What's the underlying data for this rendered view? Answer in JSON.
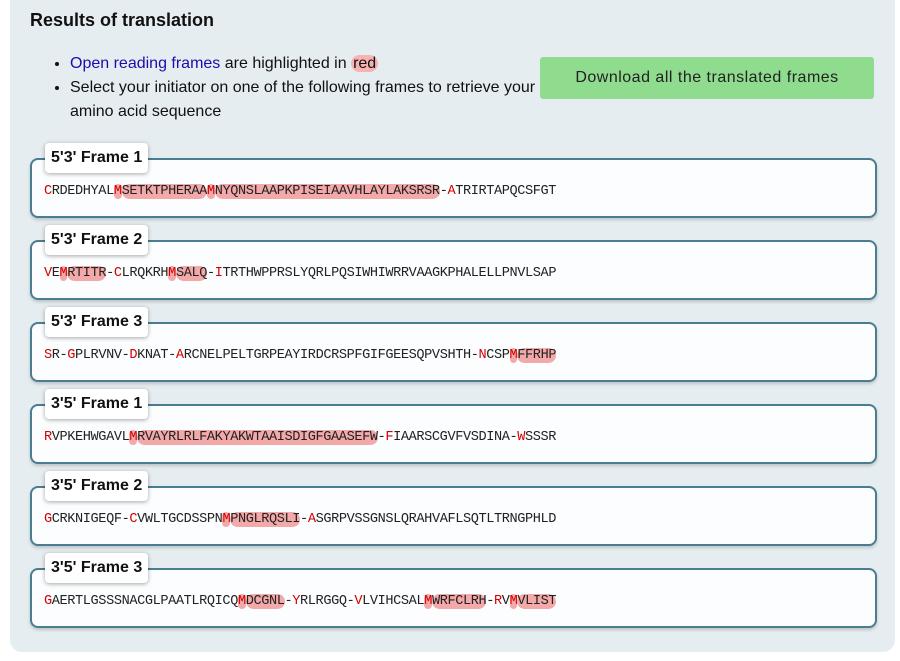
{
  "heading": "Results of translation",
  "info": {
    "orf_link": "Open reading frames",
    "orf_mid": " are highlighted in ",
    "orf_red": "red",
    "instruction": "Select your initiator on one of the following frames to retrieve your amino acid sequence"
  },
  "download_button": "Download all the translated frames",
  "colors": {
    "highlight": "#f3a9a9",
    "start_red": "#d40000",
    "button_green": "#8fdc8f",
    "frame_border": "#4a7d91"
  },
  "frames": [
    {
      "label": "5'3' Frame 1",
      "segments": [
        {
          "t": "C",
          "k": "r"
        },
        {
          "t": "RDEDHYAL",
          "k": "n"
        },
        {
          "t": "M",
          "k": "or"
        },
        {
          "t": "SETKTPHERAA",
          "k": "o"
        },
        {
          "t": "M",
          "k": "or"
        },
        {
          "t": "NYQNSLAAPKPISEIAAVHLAYLAKSRSR",
          "k": "o"
        },
        {
          "t": "-",
          "k": "n"
        },
        {
          "t": "A",
          "k": "r"
        },
        {
          "t": "TRIRTAPQCSFGT",
          "k": "n"
        }
      ]
    },
    {
      "label": "5'3' Frame 2",
      "segments": [
        {
          "t": "V",
          "k": "r"
        },
        {
          "t": "E",
          "k": "n"
        },
        {
          "t": "M",
          "k": "or"
        },
        {
          "t": "RTITR",
          "k": "o"
        },
        {
          "t": "-",
          "k": "n"
        },
        {
          "t": "C",
          "k": "r"
        },
        {
          "t": "LRQKRH",
          "k": "n"
        },
        {
          "t": "M",
          "k": "or"
        },
        {
          "t": "SALQ",
          "k": "o"
        },
        {
          "t": "-",
          "k": "n"
        },
        {
          "t": "I",
          "k": "r"
        },
        {
          "t": "TRTHWPPRSLYQRLPQSIWHIWRRVAAGKPHALELLPNVLSAP",
          "k": "n"
        }
      ]
    },
    {
      "label": "5'3' Frame 3",
      "segments": [
        {
          "t": "S",
          "k": "r"
        },
        {
          "t": "R-",
          "k": "n"
        },
        {
          "t": "G",
          "k": "r"
        },
        {
          "t": "PLRVNV-",
          "k": "n"
        },
        {
          "t": "D",
          "k": "r"
        },
        {
          "t": "KNAT-",
          "k": "n"
        },
        {
          "t": "A",
          "k": "r"
        },
        {
          "t": "RCNELPELTGRPEAYIRDCRSPFGIFGEESQPVSHTH-",
          "k": "n"
        },
        {
          "t": "N",
          "k": "r"
        },
        {
          "t": "CSP",
          "k": "n"
        },
        {
          "t": "M",
          "k": "or"
        },
        {
          "t": "FFRHP",
          "k": "o"
        }
      ]
    },
    {
      "label": "3'5' Frame 1",
      "segments": [
        {
          "t": "R",
          "k": "r"
        },
        {
          "t": "VPKEHWGAVL",
          "k": "n"
        },
        {
          "t": "M",
          "k": "or"
        },
        {
          "t": "RVAYRLRLFAKYAKWTAAISDIGFGAASEFW",
          "k": "o"
        },
        {
          "t": "-",
          "k": "n"
        },
        {
          "t": "F",
          "k": "r"
        },
        {
          "t": "IAARSCGVFVSDINA-",
          "k": "n"
        },
        {
          "t": "W",
          "k": "r"
        },
        {
          "t": "SSSR",
          "k": "n"
        }
      ]
    },
    {
      "label": "3'5' Frame 2",
      "segments": [
        {
          "t": "G",
          "k": "r"
        },
        {
          "t": "CRKNIGEQF-",
          "k": "n"
        },
        {
          "t": "C",
          "k": "r"
        },
        {
          "t": "VWLTGCDSSPN",
          "k": "n"
        },
        {
          "t": "M",
          "k": "or"
        },
        {
          "t": "PNGLRQSLI",
          "k": "o"
        },
        {
          "t": "-",
          "k": "n"
        },
        {
          "t": "A",
          "k": "r"
        },
        {
          "t": "SGRPVSSGNSLQRAHVAFLSQTLTRNGPHLD",
          "k": "n"
        }
      ]
    },
    {
      "label": "3'5' Frame 3",
      "segments": [
        {
          "t": "G",
          "k": "r"
        },
        {
          "t": "AERTLGSSSNACGLPAATLRQICQ",
          "k": "n"
        },
        {
          "t": "M",
          "k": "or"
        },
        {
          "t": "DCGNL",
          "k": "o"
        },
        {
          "t": "-",
          "k": "n"
        },
        {
          "t": "Y",
          "k": "r"
        },
        {
          "t": "RLRGGQ-",
          "k": "n"
        },
        {
          "t": "V",
          "k": "r"
        },
        {
          "t": "LVIHCSAL",
          "k": "n"
        },
        {
          "t": "M",
          "k": "or"
        },
        {
          "t": "WRFCLRH",
          "k": "o"
        },
        {
          "t": "-",
          "k": "n"
        },
        {
          "t": "R",
          "k": "r"
        },
        {
          "t": "V",
          "k": "n"
        },
        {
          "t": "M",
          "k": "or"
        },
        {
          "t": "VLIST",
          "k": "o"
        }
      ]
    }
  ]
}
